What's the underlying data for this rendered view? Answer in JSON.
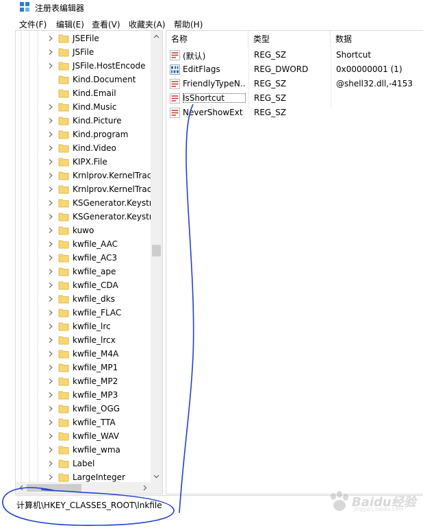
{
  "window": {
    "title": "注册表编辑器"
  },
  "menu": [
    "文件(F)",
    "编辑(E)",
    "查看(V)",
    "收藏夹(A)",
    "帮助(H)"
  ],
  "tree": {
    "items": [
      "JSEFile",
      "JSFile",
      "JSFile.HostEncode",
      "Kind.Document",
      "Kind.Email",
      "Kind.Music",
      "Kind.Picture",
      "Kind.program",
      "Kind.Video",
      "KIPX.File",
      "Krnlprov.KernelTrac",
      "Krnlprov.KernelTrac",
      "KSGenerator.Keystr",
      "KSGenerator.Keystr",
      "kuwo",
      "kwfile_AAC",
      "kwfile_AC3",
      "kwfile_ape",
      "kwfile_CDA",
      "kwfile_dks",
      "kwfile_FLAC",
      "kwfile_lrc",
      "kwfile_lrcx",
      "kwfile_M4A",
      "kwfile_MP1",
      "kwfile_MP2",
      "kwfile_MP3",
      "kwfile_OGG",
      "kwfile_TTA",
      "kwfile_WAV",
      "kwfile_wma",
      "Label",
      "LargeInteger"
    ],
    "expandable": [
      true,
      true,
      true,
      false,
      false,
      true,
      true,
      true,
      true,
      true,
      true,
      true,
      true,
      true,
      true,
      true,
      true,
      true,
      true,
      true,
      true,
      true,
      true,
      true,
      true,
      true,
      true,
      true,
      true,
      true,
      true,
      true,
      true
    ]
  },
  "list": {
    "headers": {
      "name": "名称",
      "type": "类型",
      "data": "数据"
    },
    "rows": [
      {
        "icon": "string-value-icon",
        "name": "(默认)",
        "type": "REG_SZ",
        "data": "Shortcut"
      },
      {
        "icon": "binary-value-icon",
        "name": "EditFlags",
        "type": "REG_DWORD",
        "data": "0x00000001 (1)"
      },
      {
        "icon": "string-value-icon",
        "name": "FriendlyTypeN...",
        "type": "REG_SZ",
        "data": "@shell32.dll,-4153"
      },
      {
        "icon": "string-value-icon",
        "name": "IsShortcut",
        "type": "REG_SZ",
        "data": ""
      },
      {
        "icon": "string-value-icon",
        "name": "NeverShowExt",
        "type": "REG_SZ",
        "data": ""
      }
    ],
    "selected_index": 3
  },
  "status": {
    "path": "计算机\\HKEY_CLASSES_ROOT\\lnkfile"
  },
  "watermark": {
    "text": "Baidu经验",
    "sub": "jingyan.baidu.com"
  },
  "colors": {
    "ink": "#1f3fd0",
    "folder": "#f7d774",
    "icon_red": "#c0392b",
    "icon_blue": "#2b5fb3"
  }
}
